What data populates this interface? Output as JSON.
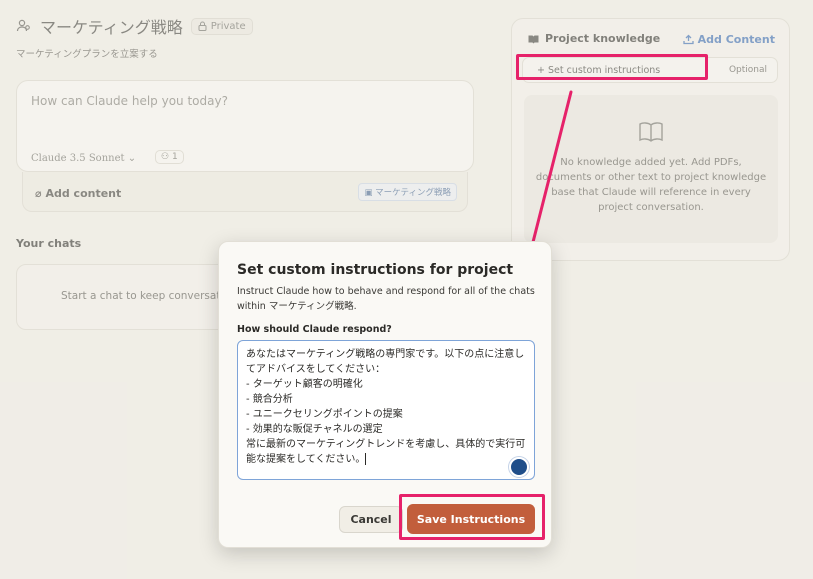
{
  "project": {
    "title": "マーケティング戦略",
    "private_badge": "Private",
    "subtitle": "マーケティングプランを立案する"
  },
  "prompt": {
    "placeholder": "How can Claude help you today?",
    "model": "Claude 3.5 Sonnet",
    "collaborators": "1",
    "add_content": "Add content",
    "project_tag": "マーケティング戦略"
  },
  "chats": {
    "heading": "Your chats",
    "empty_text": "Start a chat to keep conversations"
  },
  "knowledge": {
    "title": "Project knowledge",
    "add_content": "Add Content",
    "custom_instructions": "+ Set custom instructions",
    "optional": "Optional",
    "empty_text": "No knowledge added yet. Add PDFs, documents or other text to project knowledge base that Claude will reference in every project conversation."
  },
  "modal": {
    "title": "Set custom instructions for project",
    "description": "Instruct Claude how to behave and respond for all of the chats within マーケティング戦略.",
    "label": "How should Claude respond?",
    "instructions": "あなたはマーケティング戦略の専門家です。以下の点に注意してアドバイスをしてください：\n- ターゲット顧客の明確化\n- 競合分析\n- ユニークセリングポイントの提案\n- 効果的な販促チャネルの選定\n常に最新のマーケティングトレンドを考慮し、具体的で実行可能な提案をしてください。",
    "cancel": "Cancel",
    "save": "Save Instructions"
  },
  "colors": {
    "accent_save": "#c25e3c",
    "highlight": "#e6226a",
    "link_blue": "#2e64b3"
  }
}
